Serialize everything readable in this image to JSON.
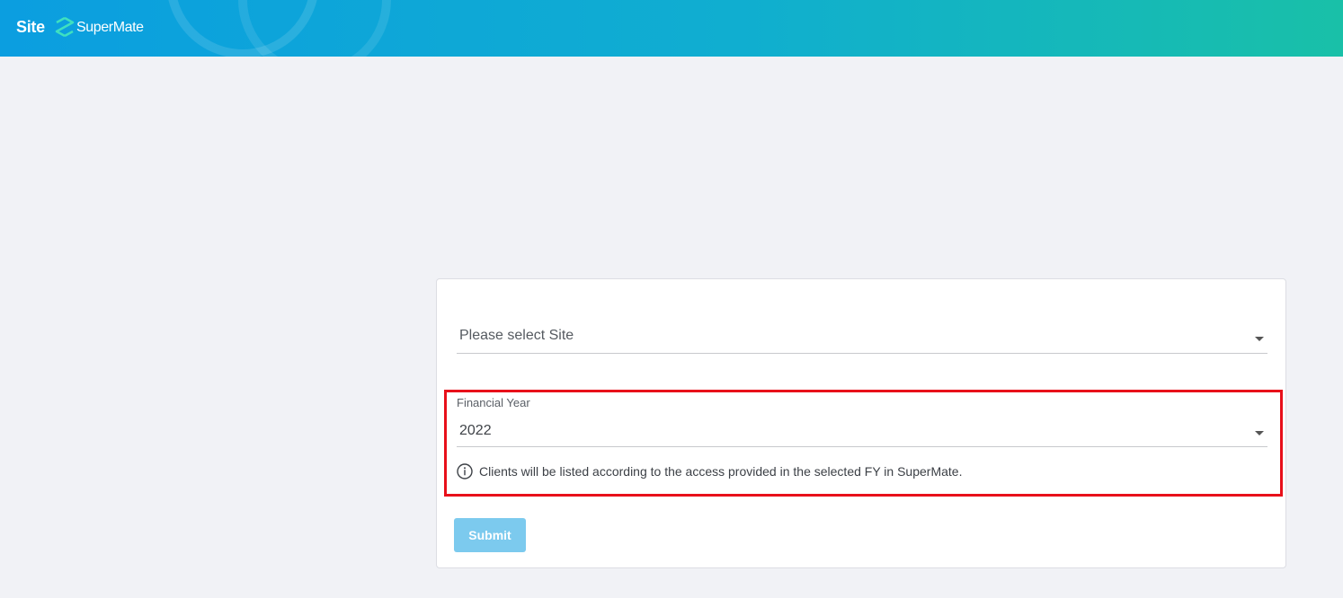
{
  "header": {
    "section_title": "Site",
    "brand_name": "SuperMate",
    "logo_icon": "supermate-s-logo-icon",
    "gradient_start": "#0b9ee0",
    "gradient_end": "#19c0a8"
  },
  "form": {
    "site_select": {
      "placeholder": "Please select Site",
      "icon": "caret-down-icon"
    },
    "financial_year": {
      "label": "Financial Year",
      "value": "2022",
      "icon": "caret-down-icon",
      "hint_icon": "info-icon",
      "hint_text": "Clients will be listed according to the access provided in the selected FY in SuperMate."
    },
    "submit_label": "Submit",
    "submit_color": "#7ccaee",
    "highlight_color": "#e8101a"
  }
}
